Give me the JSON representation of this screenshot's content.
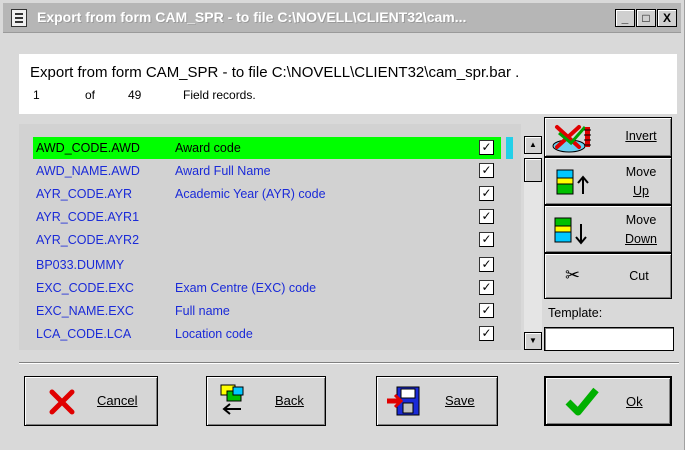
{
  "window": {
    "title": "Export from form CAM_SPR - to file C:\\NOVELL\\CLIENT32\\cam..."
  },
  "title_controls": {
    "minimize": "_",
    "maximize": "□",
    "close": "X"
  },
  "header": {
    "export_line": "Export from form CAM_SPR - to file C:\\NOVELL\\CLIENT32\\cam_spr.bar .",
    "current_record": "1",
    "of_label": "of",
    "total_records": "49",
    "records_label": "Field records."
  },
  "fields": [
    {
      "code": "AWD_CODE.AWD",
      "description": "Award code",
      "checked": true,
      "selected": true
    },
    {
      "code": "AWD_NAME.AWD",
      "description": "Award Full Name",
      "checked": true,
      "selected": false
    },
    {
      "code": "AYR_CODE.AYR",
      "description": "Academic Year (AYR) code",
      "checked": true,
      "selected": false
    },
    {
      "code": "AYR_CODE.AYR1",
      "description": "",
      "checked": true,
      "selected": false
    },
    {
      "code": "AYR_CODE.AYR2",
      "description": "",
      "checked": true,
      "selected": false
    },
    {
      "code": "BP033.DUMMY",
      "description": "",
      "checked": true,
      "selected": false
    },
    {
      "code": "EXC_CODE.EXC",
      "description": "Exam Centre (EXC) code",
      "checked": true,
      "selected": false
    },
    {
      "code": "EXC_NAME.EXC",
      "description": "Full name",
      "checked": true,
      "selected": false
    },
    {
      "code": "LCA_CODE.LCA",
      "description": "Location code",
      "checked": true,
      "selected": false
    }
  ],
  "check_mark": "✓",
  "scrollbar": {
    "up": "▲",
    "down": "▼"
  },
  "side_buttons": {
    "invert": "Invert",
    "move_up_1": "Move",
    "move_up_2": "Up",
    "move_down_1": "Move",
    "move_down_2": "Down",
    "cut": "Cut",
    "cut_glyph": "✂"
  },
  "template": {
    "label": "Template:",
    "value": ""
  },
  "bottom_buttons": {
    "cancel": "Cancel",
    "back": "Back",
    "save": "Save",
    "ok": "Ok"
  },
  "colors": {
    "selection": "#00ff00",
    "field_text": "#1a2ad8",
    "cancel_x": "#e00000",
    "ok_check": "#00b000"
  }
}
